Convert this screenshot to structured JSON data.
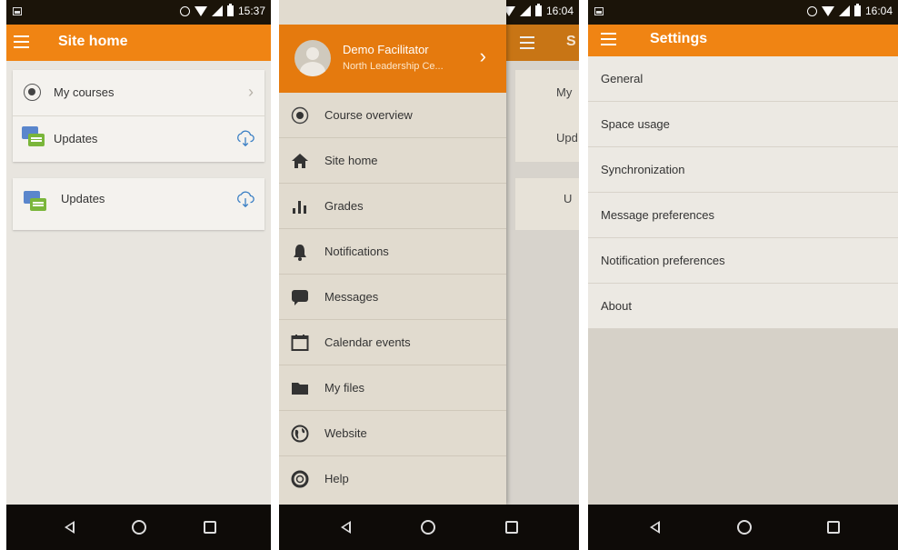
{
  "screen1": {
    "status_time": "15:37",
    "title": "Site home",
    "card1": [
      {
        "label": "My courses",
        "icon": "course-icon",
        "trailing": "chevron-right-icon"
      },
      {
        "label": "Updates",
        "icon": "forum-icon",
        "trailing": "cloud-download-icon"
      }
    ],
    "card2": {
      "label": "Updates",
      "icon": "forum-icon",
      "trailing": "cloud-download-icon"
    }
  },
  "screen2": {
    "status_time": "16:04",
    "user_name": "Demo Facilitator",
    "user_site": "North Leadership Ce...",
    "behind_title": "S",
    "behind_rows": [
      "My",
      "Upd",
      "U"
    ],
    "menu": [
      {
        "label": "Course overview",
        "icon": "course-overview-icon"
      },
      {
        "label": "Site home",
        "icon": "home-icon"
      },
      {
        "label": "Grades",
        "icon": "grades-icon"
      },
      {
        "label": "Notifications",
        "icon": "bell-icon"
      },
      {
        "label": "Messages",
        "icon": "chat-icon"
      },
      {
        "label": "Calendar events",
        "icon": "calendar-icon"
      },
      {
        "label": "My files",
        "icon": "folder-icon"
      },
      {
        "label": "Website",
        "icon": "globe-icon"
      },
      {
        "label": "Help",
        "icon": "lifebuoy-icon"
      }
    ]
  },
  "screen3": {
    "status_time": "16:04",
    "title": "Settings",
    "items": [
      "General",
      "Space usage",
      "Synchronization",
      "Message preferences",
      "Notification preferences",
      "About"
    ]
  },
  "colors": {
    "accent": "#f08413",
    "background": "#e8e5df",
    "statusbar": "#1b1409"
  }
}
